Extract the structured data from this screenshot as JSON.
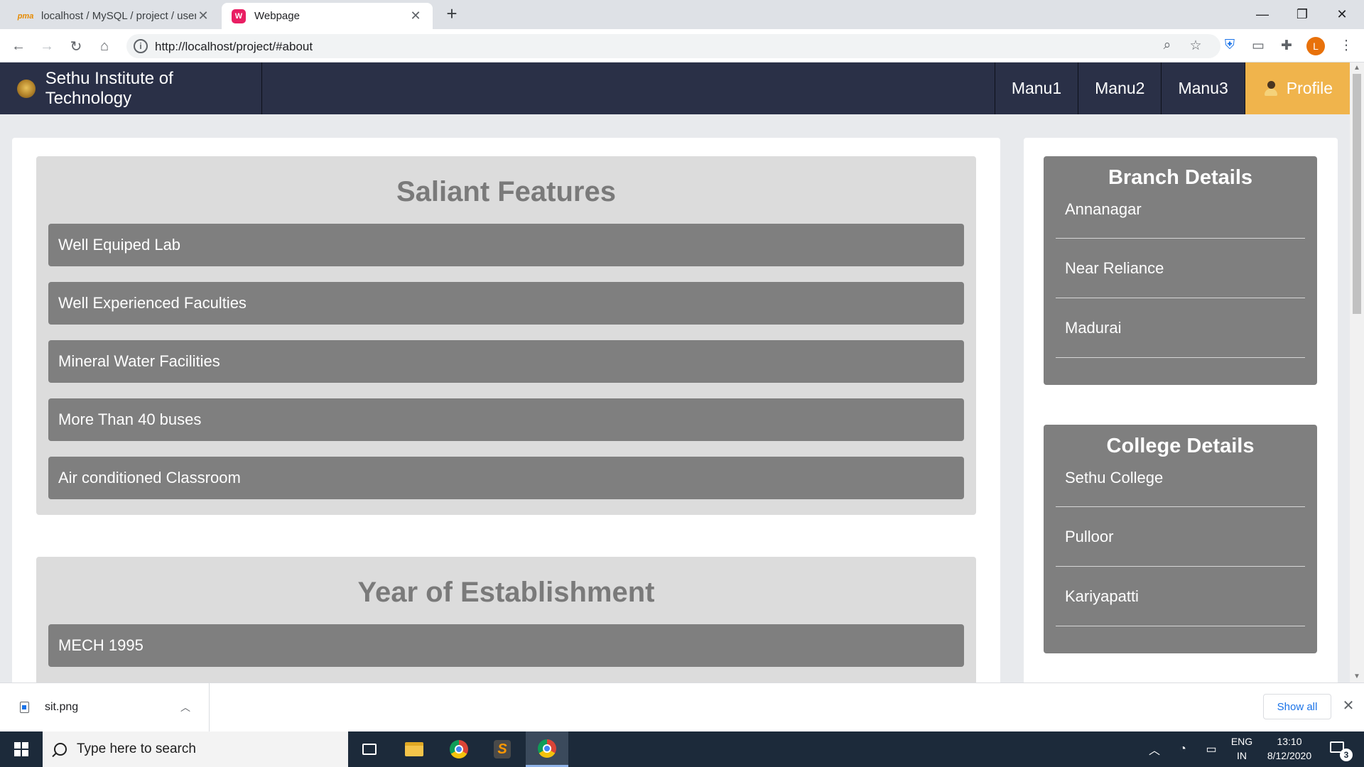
{
  "browser": {
    "tabs": [
      {
        "title": "localhost / MySQL / project / users",
        "favicon": "phpmyadmin-icon"
      },
      {
        "title": "Webpage",
        "favicon": "webpage-icon"
      }
    ],
    "new_tab": "+",
    "url": "http://localhost/project/#about",
    "profile_initial": "L"
  },
  "site": {
    "brand": "Sethu Institute of Technology",
    "nav": [
      "Manu1",
      "Manu2",
      "Manu3"
    ],
    "profile": "Profile",
    "colors": {
      "navbar": "#2a3047",
      "profile": "#f0b44c",
      "card": "#dcdcdc",
      "item": "#7f7f7f"
    }
  },
  "features": {
    "title": "Saliant Features",
    "items": [
      "Well Equiped Lab",
      "Well Experienced Faculties",
      "Mineral Water Facilities",
      "More Than 40 buses",
      "Air conditioned Classroom"
    ]
  },
  "establishment": {
    "title": "Year of Establishment",
    "items": [
      "MECH 1995"
    ]
  },
  "branch": {
    "title": "Branch Details",
    "items": [
      "Annanagar",
      "Near Reliance",
      "Madurai"
    ]
  },
  "college": {
    "title": "College Details",
    "items": [
      "Sethu College",
      "Pulloor",
      "Kariyapatti"
    ]
  },
  "downloads": {
    "file": "sit.png",
    "show_all": "Show all"
  },
  "taskbar": {
    "search_placeholder": "Type here to search",
    "lang_line1": "ENG",
    "lang_line2": "IN",
    "time": "13:10",
    "date": "8/12/2020",
    "notifications": "3"
  }
}
